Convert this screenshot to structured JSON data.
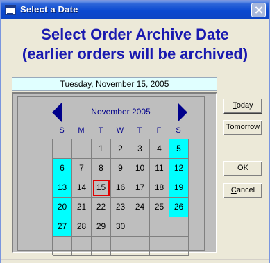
{
  "window": {
    "title": "Select a Date"
  },
  "heading": {
    "line1": "Select Order Archive Date",
    "line2": "(earlier orders will be archived)"
  },
  "selected_date_display": "Tuesday, November 15, 2005",
  "calendar": {
    "month_label": "November 2005",
    "weekdays": [
      "S",
      "M",
      "T",
      "W",
      "T",
      "F",
      "S"
    ],
    "weeks": [
      [
        "",
        "",
        "1",
        "2",
        "3",
        "4",
        "5"
      ],
      [
        "6",
        "7",
        "8",
        "9",
        "10",
        "11",
        "12"
      ],
      [
        "13",
        "14",
        "15",
        "16",
        "17",
        "18",
        "19"
      ],
      [
        "20",
        "21",
        "22",
        "23",
        "24",
        "25",
        "26"
      ],
      [
        "27",
        "28",
        "29",
        "30",
        "",
        "",
        ""
      ],
      [
        "",
        "",
        "",
        "",
        "",
        "",
        ""
      ]
    ],
    "selected_day": "15",
    "weekend_color": "#00ffff",
    "selected_border_color": "#e00000"
  },
  "buttons": {
    "today": "Today",
    "tomorrow": "Tomorrow",
    "ok": "OK",
    "cancel": "Cancel"
  },
  "colors": {
    "heading": "#1a1ab0",
    "nav_arrow": "#00008b",
    "date_display_bg": "#e0ffff"
  }
}
